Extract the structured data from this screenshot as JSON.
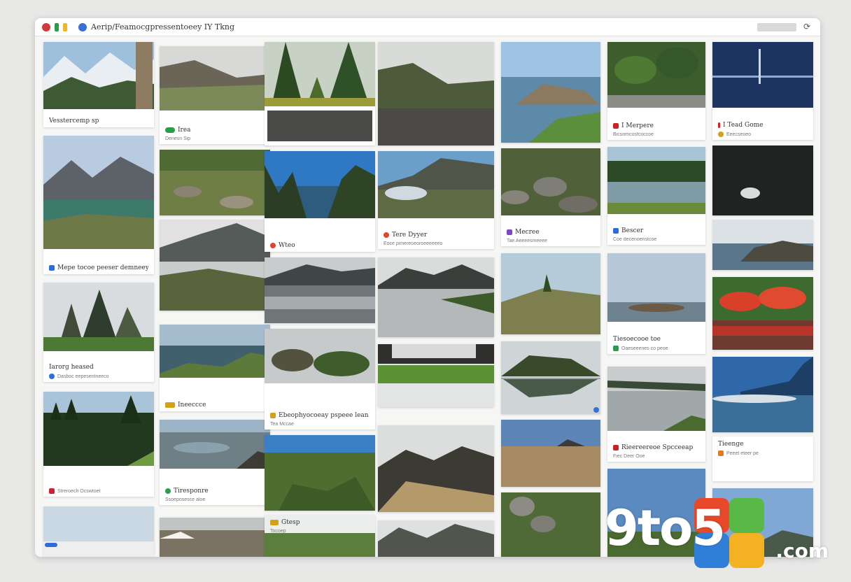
{
  "window": {
    "title": "Aerip/Feamocgpressentoeey IY Tkng",
    "menu_glyph": "⟳"
  },
  "colors": {
    "close": "#d23a3a",
    "minimize": "#f3b42c",
    "maximize": "#35a853",
    "app_icon": "#3a6fd8"
  },
  "cards": [
    {
      "col": 0,
      "title": "Vesstercemp sp",
      "sub": "",
      "chip": ""
    },
    {
      "col": 0,
      "title": "Mepe tocoe peeser demneey",
      "sub": "",
      "chip": "#2d6cdf"
    },
    {
      "col": 0,
      "title": "Iarorg heased",
      "sub": "Dasboc eepesentneeco",
      "chip": "#2d6cdf"
    },
    {
      "col": 0,
      "title": "Streroech Ocswtoet",
      "sub": "",
      "chip": "#c23"
    },
    {
      "col": 1,
      "title": "Irea",
      "sub": "Denesn Sip",
      "chip": "#2a9d4a"
    },
    {
      "col": 1,
      "title": "Ineeccce",
      "sub": "",
      "chip": "#d4a017"
    },
    {
      "col": 1,
      "title": "Tiresponre",
      "sub": "Ssoeposesce aloe",
      "chip": "#2a9d4a"
    },
    {
      "col": 2,
      "title": "Wteo",
      "sub": "",
      "chip": "#e0452b"
    },
    {
      "col": 2,
      "title": "Ebeophyocoeay pspeee lean",
      "sub": "Tea Mccae",
      "chip": "#d4a017"
    },
    {
      "col": 2,
      "title": "Gtesp",
      "sub": "Tocoep",
      "chip": "#d4a017"
    },
    {
      "col": 3,
      "title": "Tere Dyyer",
      "sub": "Eoce pimereoeoroeeeeeeo",
      "chip": "#e0452b"
    },
    {
      "col": 4,
      "title": "Mecree",
      "sub": "Tae Aeeeesmeeee",
      "chip": "#7a45c8"
    },
    {
      "col": 5,
      "title": "I Merpere",
      "sub": "Bicsomcosfcoccoe",
      "chip": "#c22"
    },
    {
      "col": 5,
      "title": "Bescer",
      "sub": "Coe decenoenstcoe",
      "chip": "#2d6cdf"
    },
    {
      "col": 5,
      "title": "Tiesoecooe toe",
      "sub": "Oaeseeenes co peoe",
      "chip": "#2a9d4a"
    },
    {
      "col": 5,
      "title": "Rieereereoe Spcceeap",
      "sub": "Fiec Deer Ooe",
      "chip": "#c22"
    },
    {
      "col": 6,
      "title": "I Tead Gome",
      "sub": "Eeecseoeo",
      "chip": "#d4a017"
    },
    {
      "col": 6,
      "title": "Tieenge",
      "sub": "Peeet eteer pe",
      "chip": "#e07a20"
    }
  ],
  "watermark": {
    "brand": "9to5",
    "suffix": ".com"
  }
}
